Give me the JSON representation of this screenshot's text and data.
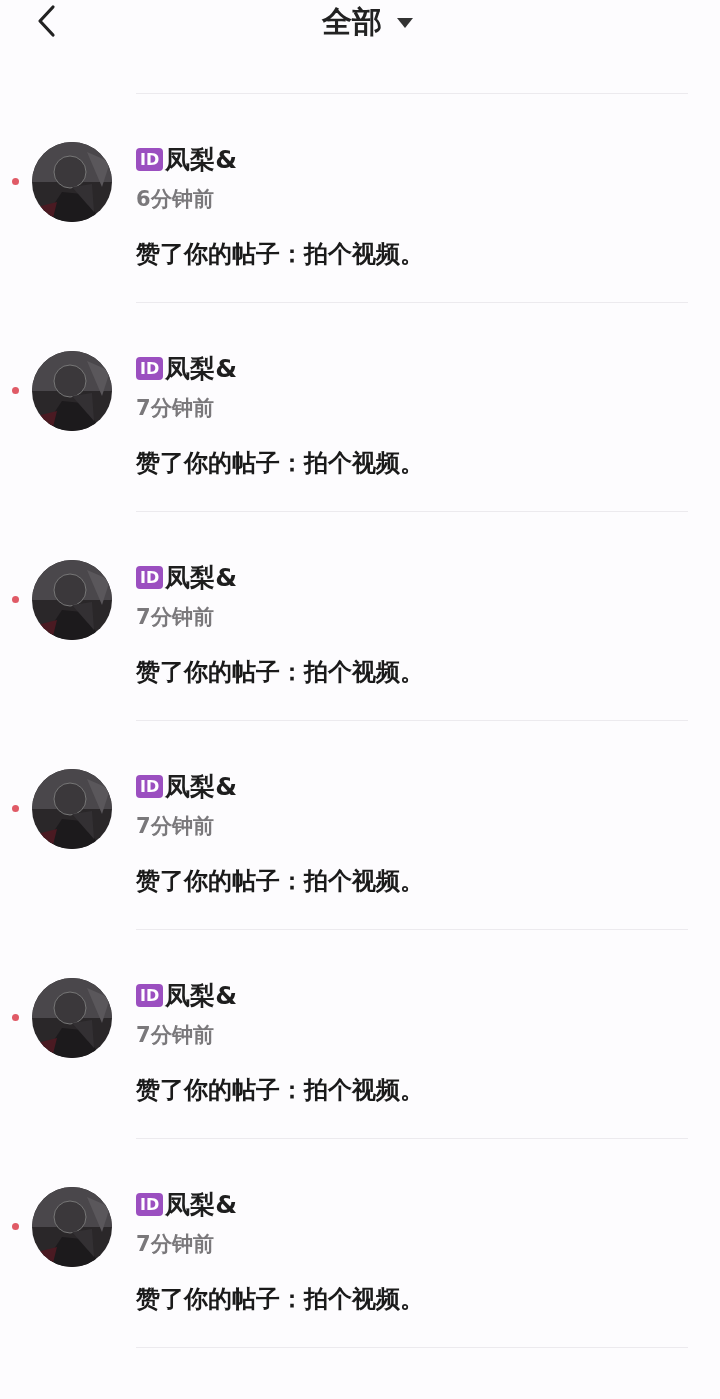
{
  "header": {
    "title": "全部"
  },
  "notifications": [
    {
      "badge": "ID",
      "name": "凤梨&",
      "time": "6分钟前",
      "message": "赞了你的帖子：拍个视频。",
      "unread": true
    },
    {
      "badge": "ID",
      "name": "凤梨&",
      "time": "7分钟前",
      "message": "赞了你的帖子：拍个视频。",
      "unread": true
    },
    {
      "badge": "ID",
      "name": "凤梨&",
      "time": "7分钟前",
      "message": "赞了你的帖子：拍个视频。",
      "unread": true
    },
    {
      "badge": "ID",
      "name": "凤梨&",
      "time": "7分钟前",
      "message": "赞了你的帖子：拍个视频。",
      "unread": true
    },
    {
      "badge": "ID",
      "name": "凤梨&",
      "time": "7分钟前",
      "message": "赞了你的帖子：拍个视频。",
      "unread": true
    },
    {
      "badge": "ID",
      "name": "凤梨&",
      "time": "7分钟前",
      "message": "赞了你的帖子：拍个视频。",
      "unread": true
    }
  ]
}
